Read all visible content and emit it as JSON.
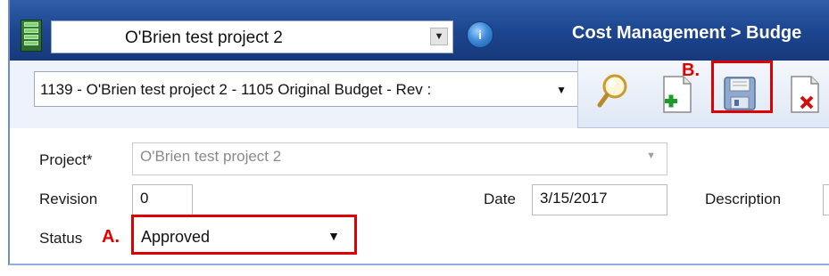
{
  "header": {
    "project_selector_value": "O'Brien test project 2",
    "breadcrumb": "Cost Management > Budge"
  },
  "record": {
    "selector_value": "1139 - O'Brien test project 2 - 1105 Original Budget - Rev :"
  },
  "toolbar": {
    "icons": [
      "search-icon",
      "add-icon",
      "save-icon",
      "delete-icon"
    ]
  },
  "annotations": {
    "a_label": "A.",
    "b_label": "B.",
    "highlight_color": "#e00000"
  },
  "form": {
    "project_label": "Project*",
    "project_value": "O'Brien test project 2",
    "revision_label": "Revision",
    "revision_value": "0",
    "date_label": "Date",
    "date_value": "3/15/2017",
    "description_label": "Description",
    "status_label": "Status",
    "status_value": "Approved"
  },
  "colors": {
    "header_blue": "#1d4690",
    "accent_red": "#e00000"
  }
}
